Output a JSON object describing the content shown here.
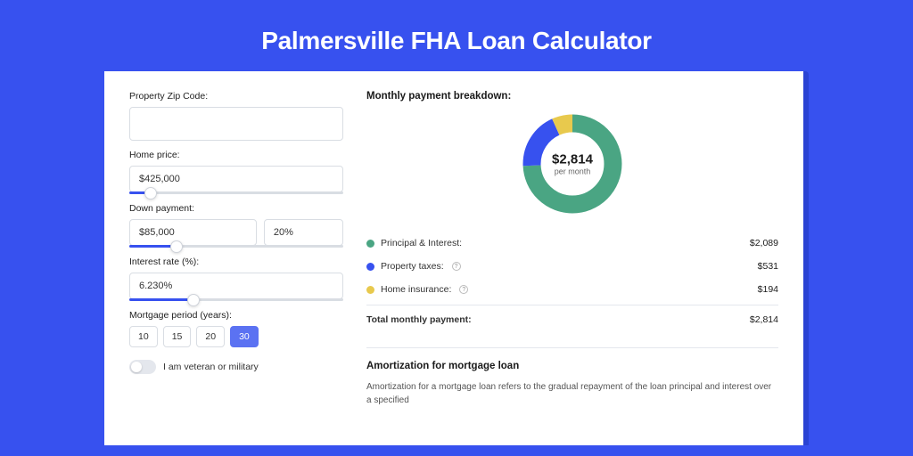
{
  "title": "Palmersville FHA Loan Calculator",
  "colors": {
    "accent": "#3751ef",
    "green": "#4aa583",
    "blue": "#3751ef",
    "yellow": "#e8c94d"
  },
  "form": {
    "zip": {
      "label": "Property Zip Code:",
      "value": ""
    },
    "home_price": {
      "label": "Home price:",
      "value": "$425,000",
      "slider_pct": 10
    },
    "down_payment": {
      "label": "Down payment:",
      "amount": "$85,000",
      "pct": "20%",
      "slider_pct": 22
    },
    "interest_rate": {
      "label": "Interest rate (%):",
      "value": "6.230%",
      "slider_pct": 30
    },
    "mortgage_period": {
      "label": "Mortgage period (years):",
      "options": [
        "10",
        "15",
        "20",
        "30"
      ],
      "selected": "30"
    },
    "veteran": {
      "label": "I am veteran or military",
      "on": false
    }
  },
  "breakdown": {
    "title": "Monthly payment breakdown:",
    "donut": {
      "amount": "$2,814",
      "sub": "per month"
    },
    "items": [
      {
        "label": "Principal & Interest:",
        "value": "$2,089",
        "color": "green",
        "info": false
      },
      {
        "label": "Property taxes:",
        "value": "$531",
        "color": "blue",
        "info": true
      },
      {
        "label": "Home insurance:",
        "value": "$194",
        "color": "yellow",
        "info": true
      }
    ],
    "total": {
      "label": "Total monthly payment:",
      "value": "$2,814"
    }
  },
  "amortization": {
    "title": "Amortization for mortgage loan",
    "text": "Amortization for a mortgage loan refers to the gradual repayment of the loan principal and interest over a specified"
  },
  "chart_data": {
    "type": "pie",
    "title": "Monthly payment breakdown",
    "series": [
      {
        "name": "Principal & Interest",
        "value": 2089,
        "color": "#4aa583"
      },
      {
        "name": "Property taxes",
        "value": 531,
        "color": "#3751ef"
      },
      {
        "name": "Home insurance",
        "value": 194,
        "color": "#e8c94d"
      }
    ],
    "total": 2814
  }
}
